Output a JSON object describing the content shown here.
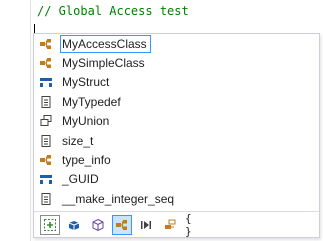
{
  "editor": {
    "comment_line": "// Global Access test"
  },
  "completion": {
    "items": [
      {
        "label": "MyAccessClass",
        "icon": "class-icon",
        "selected": true
      },
      {
        "label": "MySimpleClass",
        "icon": "class-icon"
      },
      {
        "label": "MyStruct",
        "icon": "struct-icon"
      },
      {
        "label": "MyTypedef",
        "icon": "typedef-icon"
      },
      {
        "label": "MyUnion",
        "icon": "union-icon"
      },
      {
        "label": "size_t",
        "icon": "typedef-icon"
      },
      {
        "label": "type_info",
        "icon": "class-icon"
      },
      {
        "label": "_GUID",
        "icon": "struct-icon"
      },
      {
        "label": "__make_integer_seq",
        "icon": "typedef-icon"
      }
    ],
    "filters": [
      {
        "name": "expand-filter-button",
        "icon": "expand-icon"
      },
      {
        "name": "namespace-filter-button",
        "icon": "namespace-icon"
      },
      {
        "name": "module-filter-button",
        "icon": "module-icon"
      },
      {
        "name": "class-filter-button",
        "icon": "class-icon",
        "active": true
      },
      {
        "name": "macro-filter-button",
        "icon": "macro-icon"
      },
      {
        "name": "enum-filter-button",
        "icon": "enum-icon"
      },
      {
        "name": "snippet-filter-button",
        "icon": "braces-icon",
        "text": "{ }"
      }
    ],
    "colors": {
      "class_orange": "#c27d1a",
      "struct_blue": "#1e5fa8",
      "selection_border": "#3399ff",
      "comment_green": "#008000"
    }
  }
}
